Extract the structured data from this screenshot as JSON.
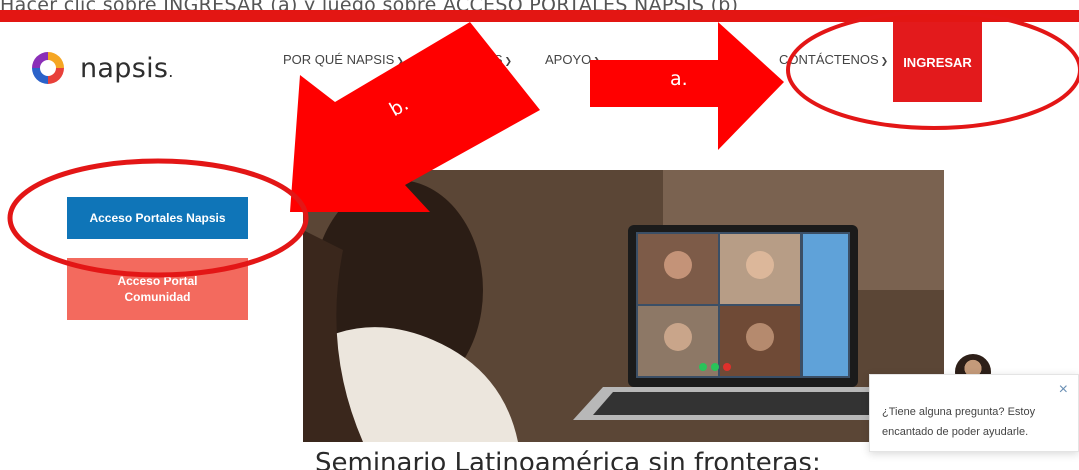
{
  "instruction": "Hacer clic sobre INGRESAR (a) y luego sobre ACCESO PORTALES NAPSIS (b)",
  "logo": {
    "text": "napsis",
    "dot": "."
  },
  "nav": [
    {
      "label": "POR QUÉ NAPSIS",
      "icon": "chevron-down-icon"
    },
    {
      "label": "PROGRAMAS",
      "icon": "chevron-down-icon"
    },
    {
      "label": "APOYO",
      "icon": "chevron-down-icon"
    },
    {
      "label": "CONTÁCTENOS",
      "icon": "chevron-down-icon"
    }
  ],
  "ingresar_label": "INGRESAR",
  "portal_buttons": {
    "napsis": "Acceso Portales Napsis",
    "comunidad_line1": "Acceso Portal",
    "comunidad_line2": "Comunidad"
  },
  "headline": "Seminario Latinoamérica sin fronteras:",
  "chat": {
    "message": "¿Tiene alguna pregunta? Estoy encantado de poder ayudarle.",
    "close": "×"
  },
  "annotations": {
    "a": "a.",
    "b": "b."
  },
  "colors": {
    "brand_red": "#e31a1c",
    "brand_blue": "#0f75b8",
    "salmon": "#f36a5e",
    "annotation_red": "#ff0000"
  }
}
